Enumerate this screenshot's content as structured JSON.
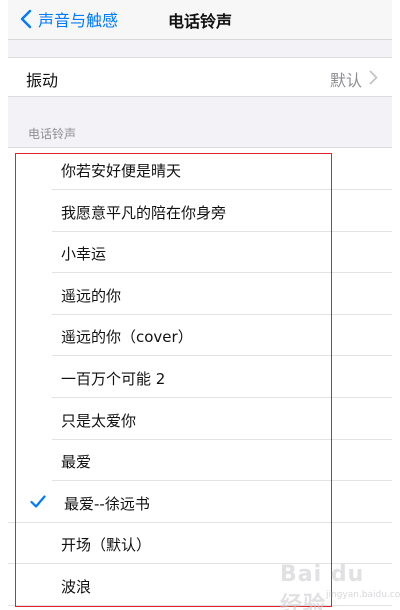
{
  "nav": {
    "back_label": "声音与触感",
    "title": "电话铃声"
  },
  "vibration": {
    "label": "振动",
    "value": "默认"
  },
  "section": {
    "header": "电话铃声"
  },
  "ringtones": [
    {
      "label": "你若安好便是晴天",
      "selected": false
    },
    {
      "label": "我愿意平凡的陪在你身旁",
      "selected": false
    },
    {
      "label": "小幸运",
      "selected": false
    },
    {
      "label": "遥远的你",
      "selected": false
    },
    {
      "label": "遥远的你（cover）",
      "selected": false
    },
    {
      "label": "一百万个可能 2",
      "selected": false
    },
    {
      "label": "只是太爱你",
      "selected": false
    },
    {
      "label": "最爱",
      "selected": false
    },
    {
      "label": "最爱--徐远书",
      "selected": true
    },
    {
      "label": "开场（默认）",
      "selected": false
    },
    {
      "label": "波浪",
      "selected": false
    }
  ],
  "colors": {
    "accent": "#007aff",
    "highlight_border": "#e0232a"
  },
  "watermark": {
    "text": "Bai du 经验",
    "sub": "jingyan.baidu.com"
  }
}
